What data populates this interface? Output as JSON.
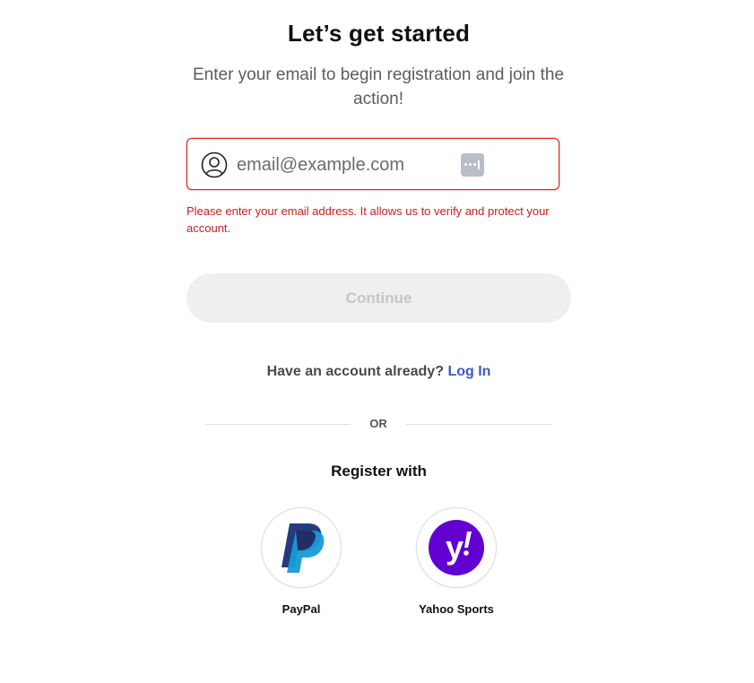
{
  "header": {
    "title": "Let’s get started",
    "subtitle": "Enter your email to begin registration and join the action!"
  },
  "email_field": {
    "placeholder": "email@example.com",
    "value": "",
    "error": "Please enter your email address. It allows us to verify and protect your account.",
    "leading_icon": "user-circle-icon",
    "trailing_icon": "password-manager-icon",
    "error_color": "#e02424"
  },
  "continue_button": {
    "label": "Continue",
    "disabled": true
  },
  "login_prompt": {
    "text": "Have an account already?",
    "link_label": "Log In",
    "link_color": "#3b5bbf"
  },
  "divider": {
    "label": "OR"
  },
  "social": {
    "heading": "Register with",
    "providers": [
      {
        "label": "PayPal",
        "icon": "paypal-logo-icon"
      },
      {
        "label": "Yahoo Sports",
        "icon": "yahoo-logo-icon",
        "brand_color": "#6001d2"
      }
    ]
  }
}
